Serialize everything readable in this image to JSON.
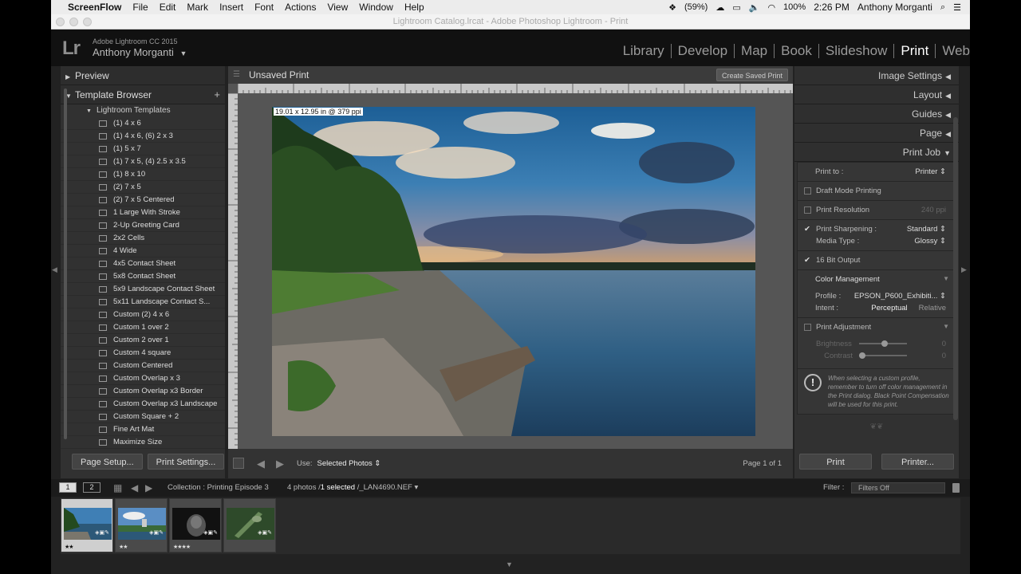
{
  "menubar": {
    "apple": "",
    "items": [
      "ScreenFlow",
      "File",
      "Edit",
      "Mark",
      "Insert",
      "Font",
      "Actions",
      "View",
      "Window",
      "Help"
    ],
    "battery_pct": "(59%)",
    "battery": "100%",
    "time": "2:26 PM",
    "user": "Anthony Morganti"
  },
  "window": {
    "title": "Lightroom Catalog.lrcat - Adobe Photoshop Lightroom - Print"
  },
  "identity": {
    "logo": "Lr",
    "version": "Adobe Lightroom CC 2015",
    "user": "Anthony Morganti",
    "user_arrow": "▼"
  },
  "modules": [
    "Library",
    "Develop",
    "Map",
    "Book",
    "Slideshow",
    "Print",
    "Web"
  ],
  "active_module": "Print",
  "left": {
    "preview": "Preview",
    "template_browser": "Template Browser",
    "plus": "+",
    "folder": "Lightroom Templates",
    "templates": [
      "(1) 4 x 6",
      "(1) 4 x 6, (6) 2 x 3",
      "(1) 5 x 7",
      "(1) 7 x 5, (4) 2.5 x 3.5",
      "(1) 8 x 10",
      "(2) 7 x 5",
      "(2) 7 x 5 Centered",
      "1 Large With Stroke",
      "2-Up Greeting Card",
      "2x2 Cells",
      "4 Wide",
      "4x5 Contact Sheet",
      "5x8 Contact Sheet",
      "5x9 Landscape Contact Sheet",
      "5x11 Landscape Contact S...",
      "Custom (2) 4 x 6",
      "Custom 1 over 2",
      "Custom 2 over 1",
      "Custom 4 square",
      "Custom Centered",
      "Custom Overlap x 3",
      "Custom Overlap x3 Border",
      "Custom Overlap x3 Landscape",
      "Custom Square + 2",
      "Fine Art Mat",
      "Maximize Size"
    ],
    "page_setup": "Page Setup...",
    "print_settings": "Print Settings..."
  },
  "center": {
    "title": "Unsaved Print",
    "create_saved": "Create Saved Print",
    "dimensions": "19.01 x 12.95 in @ 379 ppi",
    "use_label": "Use:",
    "use_value": "Selected Photos ⇕",
    "page_info": "Page 1 of 1"
  },
  "right": {
    "sections": [
      "Image Settings",
      "Layout",
      "Guides",
      "Page"
    ],
    "print_job": "Print Job",
    "print_to_label": "Print to :",
    "print_to_value": "Printer ⇕",
    "draft": "Draft Mode Printing",
    "resolution": "Print Resolution",
    "resolution_value": "240 ppi",
    "sharpening": "Print Sharpening :",
    "sharpening_value": "Standard ⇕",
    "media_type": "Media Type :",
    "media_value": "Glossy ⇕",
    "bit16": "16 Bit Output",
    "color_mgmt": "Color Management",
    "profile_label": "Profile :",
    "profile_value": "EPSON_P600_Exhibiti... ⇕",
    "intent_label": "Intent :",
    "intent_perceptual": "Perceptual",
    "intent_relative": "Relative",
    "print_adjust": "Print Adjustment",
    "brightness": "Brightness",
    "contrast": "Contrast",
    "adj_value": "0",
    "warning": "When selecting a custom profile, remember to turn off color management in the Print dialog. Black Point Compensation will be used for this print.",
    "print_btn": "Print",
    "printer_btn": "Printer..."
  },
  "filmstrip_bar": {
    "n1": "1",
    "n2": "2",
    "collection": "Collection : Printing Episode 3",
    "count_pre": "4 photos /",
    "count_sel": "1 selected",
    "count_post": "/_LAN4690.NEF ▾",
    "filter_label": "Filter :",
    "filter_value": "Filters Off"
  },
  "thumbs": [
    {
      "stars": "★★",
      "selected": true
    },
    {
      "stars": "★★",
      "selected": false
    },
    {
      "stars": "★★★★",
      "selected": false
    },
    {
      "stars": "",
      "selected": false
    }
  ]
}
